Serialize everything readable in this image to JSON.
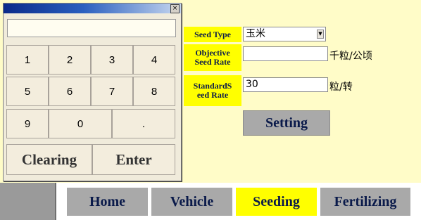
{
  "keypad": {
    "display_value": "",
    "keys": [
      "1",
      "2",
      "3",
      "4",
      "5",
      "6",
      "7",
      "8",
      "9",
      "0",
      "."
    ],
    "clear_label": "Clearing",
    "enter_label": "Enter",
    "close_glyph": "×"
  },
  "form": {
    "seed_type": {
      "label": "Seed Type",
      "value": "玉米"
    },
    "objective_seed_rate": {
      "label_line1": "Objective",
      "label_line2": "Seed Rate",
      "value": "",
      "unit": "千粒/公顷"
    },
    "standard_seed_rate": {
      "label_line1": "StandardS",
      "label_line2": "eed Rate",
      "value": "30",
      "unit": "粒/转"
    },
    "setting_label": "Setting"
  },
  "nav": {
    "tabs": [
      "Home",
      "Vehicle",
      "Seeding",
      "Fertilizing"
    ],
    "active": "Seeding"
  },
  "colors": {
    "background": "#fffcc8",
    "label_yellow": "#ffff00",
    "tab_gray": "#a9a9a9",
    "text_navy": "#0a1a4a"
  }
}
